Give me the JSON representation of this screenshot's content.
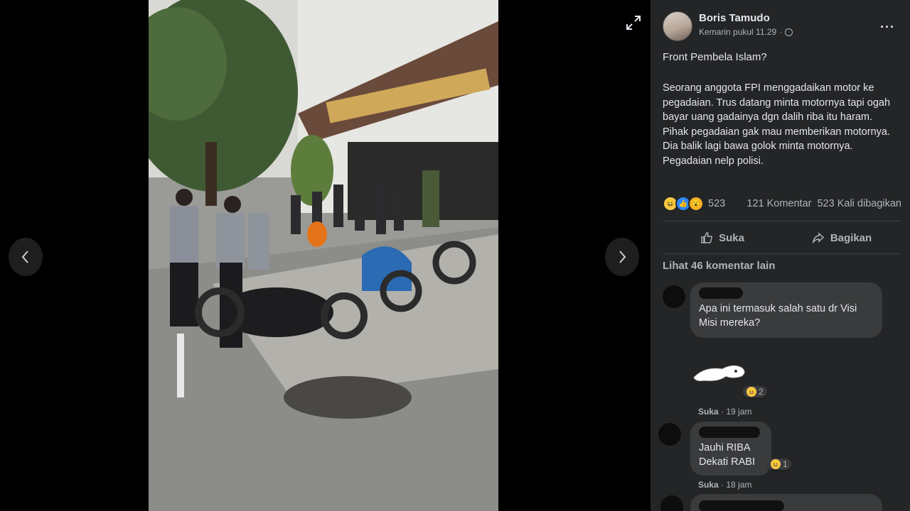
{
  "viewer": {
    "prev_label": "previous photo",
    "next_label": "next photo",
    "expand_label": "expand"
  },
  "post": {
    "author": "Boris Tamudo",
    "timestamp": "Kemarin pukul 11.29",
    "privacy_icon": "globe-icon",
    "title": "Front Pembela Islam?",
    "body": "Seorang anggota FPI menggadaikan motor ke pegadaian. Trus datang minta motornya tapi ogah bayar uang gadainya dgn dalih riba itu haram. Pihak pegadaian gak mau memberikan motornya. Dia balik lagi bawa golok minta motornya. Pegadaian nelp polisi.",
    "reaction_count": "523",
    "comment_count": "121 Komentar",
    "share_count": "523 Kali dibagikan",
    "like_label": "Suka",
    "share_label": "Bagikan",
    "more_comments": "Lihat 46 komentar lain"
  },
  "comments": [
    {
      "text": "Apa ini termasuk salah satu dr Visi Misi mereka?",
      "like": "Suka",
      "time": "19 jam",
      "reaction_count": "2"
    },
    {
      "line1": "Jauhi RIBA",
      "line2": "Dekati RABI",
      "like": "Suka",
      "time": "18 jam",
      "reaction_count": "1"
    }
  ],
  "colors": {
    "panel_bg": "#242526",
    "bubble_bg": "#3a3b3c",
    "text_primary": "#e4e6eb",
    "text_secondary": "#b0b3b8",
    "like_blue": "#2d88ff",
    "haha_yellow": "#f7c948"
  }
}
